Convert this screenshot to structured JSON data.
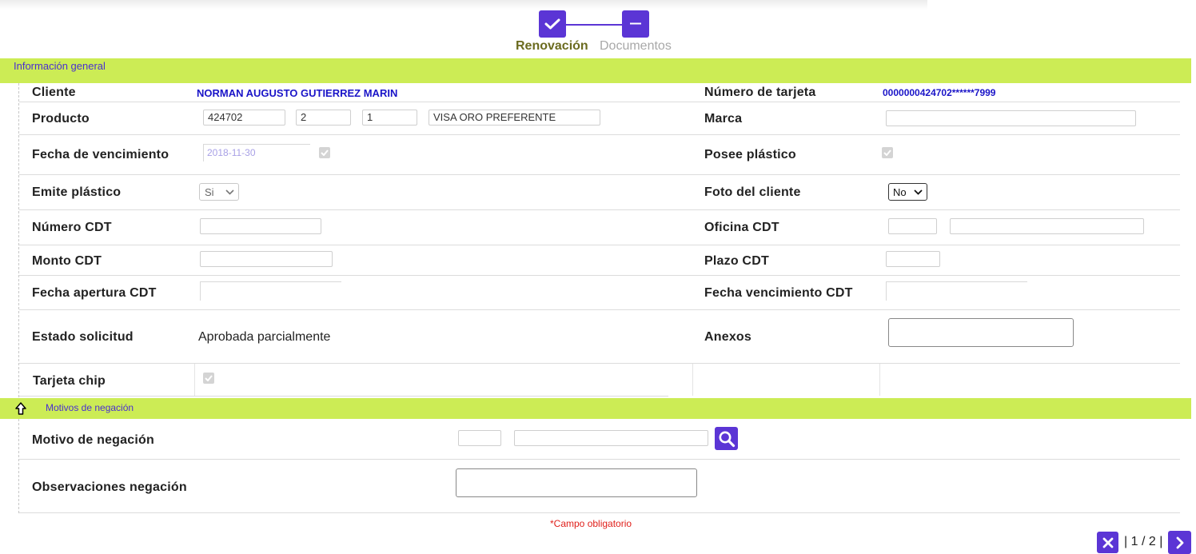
{
  "steps": [
    {
      "label": "Renovación",
      "state": "done",
      "icon": "check-icon"
    },
    {
      "label": "Documentos",
      "state": "pending",
      "icon": "minus-icon"
    }
  ],
  "section_general": {
    "title": "Información general"
  },
  "fields": {
    "cliente": {
      "label": "Cliente",
      "value": "NORMAN AUGUSTO GUTIERREZ MARIN"
    },
    "numero_tarjeta": {
      "label": "Número de tarjeta",
      "value": "0000000424702******7999"
    },
    "producto": {
      "label": "Producto",
      "values": [
        "424702",
        "2",
        "1",
        "VISA ORO PREFERENTE"
      ]
    },
    "marca": {
      "label": "Marca",
      "value": ""
    },
    "fecha_vencimiento": {
      "label": "Fecha de vencimiento",
      "value": "2018-11-30",
      "checked": true
    },
    "posee_plastico": {
      "label": "Posee plástico",
      "checked": true
    },
    "emite_plastico": {
      "label": "Emite plástico",
      "selected": "Si"
    },
    "foto_cliente": {
      "label": "Foto del cliente",
      "selected": "No"
    },
    "numero_cdt": {
      "label": "Número CDT",
      "value": ""
    },
    "oficina_cdt": {
      "label": "Oficina CDT",
      "code": "",
      "name": ""
    },
    "monto_cdt": {
      "label": "Monto CDT",
      "value": ""
    },
    "plazo_cdt": {
      "label": "Plazo CDT",
      "value": ""
    },
    "fecha_apertura_cdt": {
      "label": "Fecha apertura CDT",
      "value": ""
    },
    "fecha_vencimiento_cdt": {
      "label": "Fecha vencimiento CDT",
      "value": ""
    },
    "estado_solicitud": {
      "label": "Estado solicitud",
      "value": "Aprobada parcialmente"
    },
    "anexos": {
      "label": "Anexos",
      "value": ""
    },
    "tarjeta_chip": {
      "label": "Tarjeta chip",
      "checked": true
    }
  },
  "section_negacion": {
    "title": "Motivos de negación",
    "collapse_icon": "arrow-up-icon",
    "motivo": {
      "label": "Motivo de negación",
      "code": "",
      "description": ""
    },
    "observaciones": {
      "label": "Observaciones negación",
      "value": ""
    }
  },
  "required_note": {
    "marker": "*",
    "text": "Campo obligatorio"
  },
  "pagination": {
    "current": "1",
    "total": "2",
    "separator": "/"
  },
  "colors": {
    "accent": "#5b35d5",
    "section_bar": "#ccec55",
    "link_blue": "#1a14c8",
    "done_step": "#6b6b1f",
    "required": "#e0201b"
  }
}
